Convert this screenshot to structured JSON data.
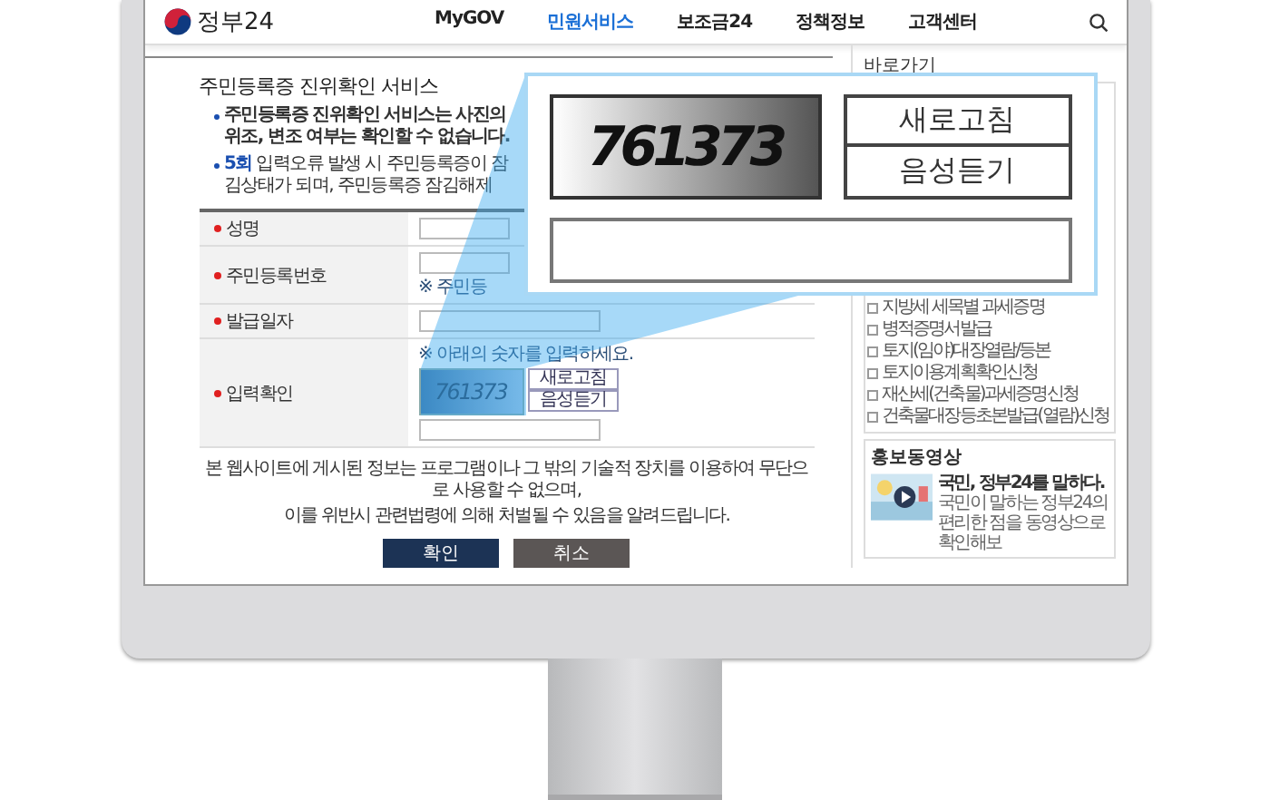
{
  "header": {
    "logo": "정부24",
    "nav": [
      {
        "label": "MyGOV",
        "selected": false
      },
      {
        "label": "민원서비스",
        "selected": true
      },
      {
        "label": "보조금24",
        "selected": false
      },
      {
        "label": "정책정보",
        "selected": false
      },
      {
        "label": "고객센터",
        "selected": false
      }
    ]
  },
  "page": {
    "title": "주민등록증 진위확인 서비스",
    "bullets": [
      {
        "text": "주민등록증 진위확인 서비스는 사진의 위조, 변조 여부는 확인할 수 없습니다.",
        "emphasis": true
      },
      {
        "text": "**5회** 입력오류 발생 시 주민등록증이 잠김상태가 되며, 주민등록증 잠김해제",
        "emphasis": false
      }
    ]
  },
  "form": {
    "rows": [
      {
        "kind": "text",
        "label": "성명",
        "required": true
      },
      {
        "kind": "text",
        "label": "주민등록번호",
        "required": true,
        "note": "※ 주민등"
      },
      {
        "kind": "text",
        "label": "발급일자",
        "required": true
      },
      {
        "kind": "captcha",
        "label": "입력확인",
        "required": true,
        "note": "※ 아래의 숫자를 입력하세요.",
        "captcha": "761373",
        "buttons": [
          "새로고침",
          "음성듣기"
        ]
      }
    ]
  },
  "notice": [
    "본 웹사이트에 게시된 정보는 프로그램이나 그 밖의 기술적 장치를 이용하여 무단으로 사용할 수 없으며,",
    "이를 위반시 관련법령에 의해 처벌될 수 있음을 알려드립니다."
  ],
  "actions": [
    {
      "label": "확인",
      "kind": "primary"
    },
    {
      "label": "취소",
      "kind": "secondary"
    }
  ],
  "sidebar": {
    "title": "바로가기",
    "items": [
      "지방세 세목별 과세증명",
      "병적증명서발급",
      "토지(임야)대장열람/등본",
      "토지이용계획확인신청",
      "재산세(건축물)과세증명신청",
      "건축물대장등초본발급(열람)신청"
    ],
    "promo": {
      "title": "홍보동영상",
      "video_title": "국민, 정부24를 말하다.",
      "description": "국민이 말하는 정부24의 편리한 점을 동영상으로 확인해보"
    }
  },
  "magnifier": {
    "captcha": "761373",
    "buttons": [
      "새로고침",
      "음성듣기"
    ]
  }
}
